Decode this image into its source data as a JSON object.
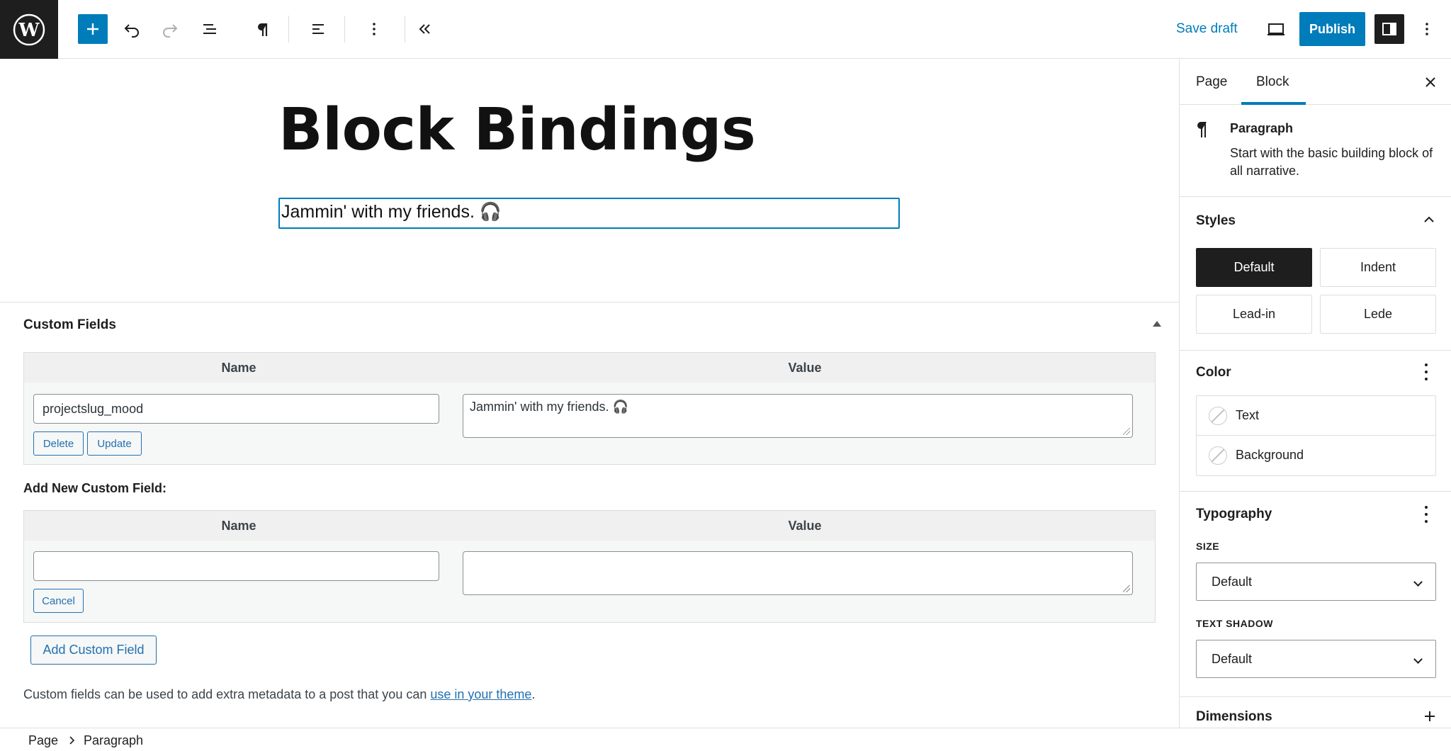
{
  "toolbar": {
    "save_draft": "Save draft",
    "publish": "Publish",
    "icons": [
      "wordpress-logo",
      "plus-icon",
      "undo-icon",
      "redo-icon",
      "document-overview-icon",
      "pilcrow-icon",
      "align-icon",
      "more-vertical-icon",
      "chevrons-left-icon",
      "desktop-preview-icon",
      "settings-sidebar-icon",
      "options-icon"
    ]
  },
  "canvas": {
    "post_title": "Block Bindings",
    "paragraph": "Jammin' with my friends. 🎧"
  },
  "custom_fields": {
    "title": "Custom Fields",
    "col_name": "Name",
    "col_value": "Value",
    "existing": {
      "name": "projectslug_mood",
      "value": "Jammin' with my friends. 🎧",
      "delete_label": "Delete",
      "update_label": "Update"
    },
    "add_new_label": "Add New Custom Field:",
    "new": {
      "name": "",
      "value": "",
      "cancel_label": "Cancel"
    },
    "add_button": "Add Custom Field",
    "help_prefix": "Custom fields can be used to add extra metadata to a post that you can ",
    "help_link": "use in your theme",
    "help_suffix": "."
  },
  "footer": {
    "crumbs": [
      "Page",
      "Paragraph"
    ]
  },
  "sidebar": {
    "tabs": [
      {
        "label": "Page",
        "active": false
      },
      {
        "label": "Block",
        "active": true
      }
    ],
    "block": {
      "title": "Paragraph",
      "description": "Start with the basic building block of all narrative."
    },
    "styles": {
      "heading": "Styles",
      "options": [
        "Default",
        "Indent",
        "Lead-in",
        "Lede"
      ],
      "active": "Default"
    },
    "color": {
      "heading": "Color",
      "items": [
        "Text",
        "Background"
      ]
    },
    "typography": {
      "heading": "Typography",
      "size_label": "SIZE",
      "size_value": "Default",
      "shadow_label": "TEXT SHADOW",
      "shadow_value": "Default"
    },
    "dimensions": {
      "heading": "Dimensions"
    }
  },
  "colors": {
    "accent": "#007cba",
    "dark": "#1e1e1e",
    "link": "#2271b1"
  }
}
